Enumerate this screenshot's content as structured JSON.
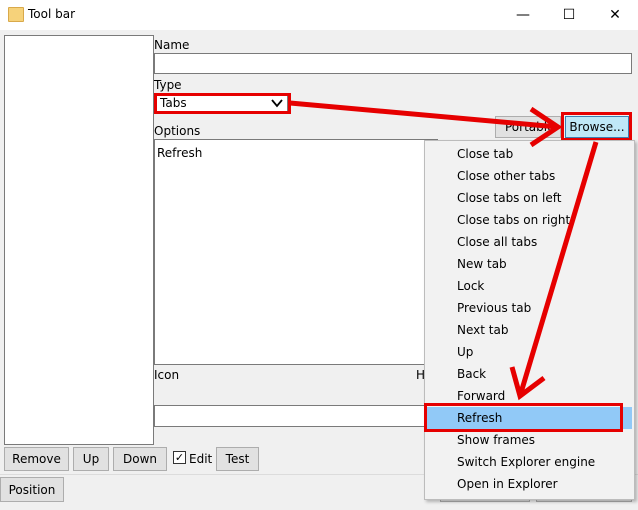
{
  "window": {
    "title": "Tool bar",
    "minimize": "—",
    "maximize": "☐",
    "close": "✕"
  },
  "form": {
    "name_label": "Name",
    "name_value": "",
    "type_label": "Type",
    "type_value": "Tabs",
    "options_label": "Options",
    "options_value": "Refresh",
    "icon_label": "Icon",
    "hidden_label_fragment": "H"
  },
  "buttons": {
    "portable": "Portable",
    "browse": "Browse...",
    "remove": "Remove",
    "up": "Up",
    "down": "Down",
    "edit": "Edit",
    "test": "Test",
    "position": "Position"
  },
  "checkbox": {
    "edit_checked": "✓"
  },
  "context_menu": {
    "items": [
      "Close tab",
      "Close other tabs",
      "Close tabs on left",
      "Close tabs on right",
      "Close all tabs",
      "New tab",
      "Lock",
      "Previous tab",
      "Next tab",
      "Up",
      "Back",
      "Forward",
      "Refresh",
      "Show frames",
      "Switch Explorer engine",
      "Open in Explorer"
    ],
    "highlighted": "Refresh"
  },
  "colors": {
    "annotation": "#e60000",
    "highlight": "#91c9f7",
    "browse_bg": "#bfe8f7"
  }
}
